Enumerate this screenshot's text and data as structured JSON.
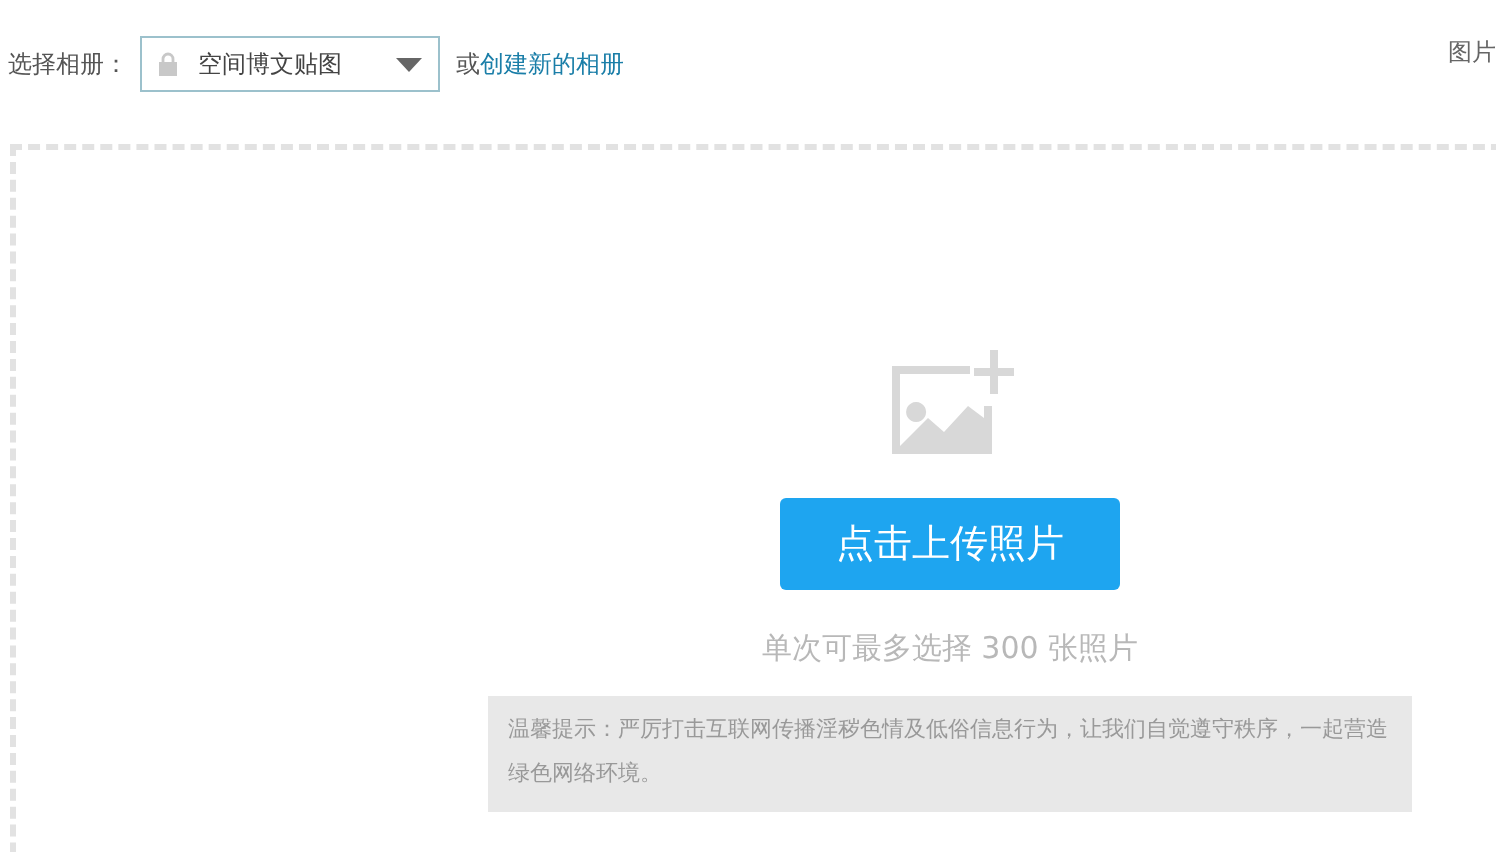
{
  "album_picker": {
    "label": "选择相册：",
    "dropdown": {
      "value": "空间博文贴图",
      "locked": true
    },
    "or_text": "或",
    "create_link": "创建新的相册"
  },
  "top_right_text": "图片",
  "upload_area": {
    "button": "点击上传照片",
    "limit_note": "单次可最多选择 300 张照片",
    "notice": "温馨提示：严厉打击互联网传播淫秽色情及低俗信息行为，让我们自觉遵守秩序，一起营造绿色网络环境。"
  }
}
